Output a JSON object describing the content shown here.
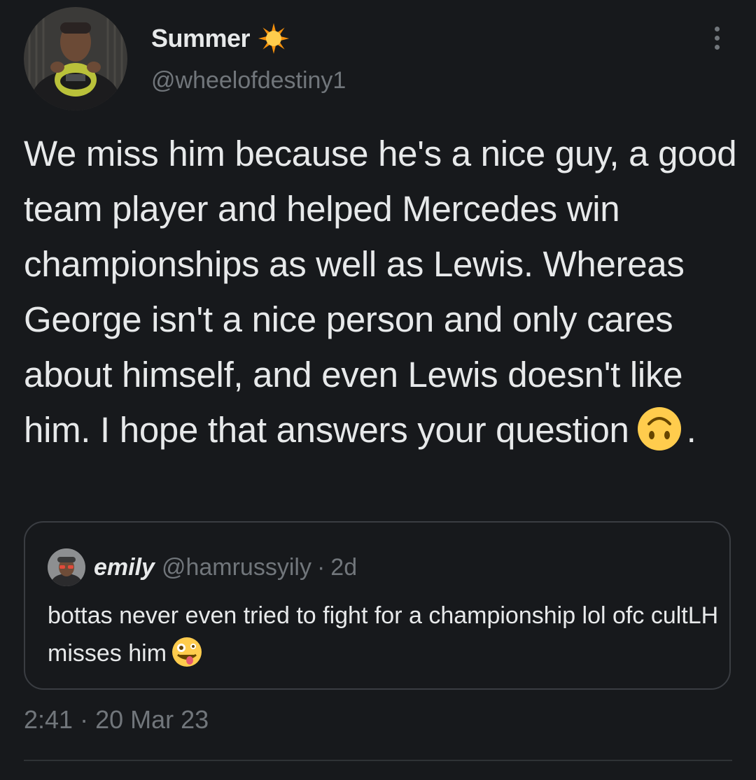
{
  "tweet": {
    "author": {
      "display_name": "Summer",
      "name_emoji": "sun-with-rays",
      "handle": "@wheelofdestiny1",
      "avatar": "profile-photo"
    },
    "menu_icon": "more-options-icon",
    "text_main": "We miss him because he's a nice guy, a good team player and helped Mercedes win championships as well as Lewis. Whereas George isn't a nice person and only cares about himself, and even Lewis doesn't like him. I hope that answers your question",
    "text_emoji": "upside-down-face",
    "text_tail": ".",
    "quoted_tweet": {
      "display_name": "emily",
      "handle": "@hamrussyily",
      "separator": "·",
      "age": "2d",
      "text": "bottas never even tried to fight for a championship lol ofc cultLH misses him",
      "text_emoji": "zany-face"
    },
    "time": "2:41",
    "separator": "·",
    "date": "20 Mar 23"
  },
  "colors": {
    "background": "#17191c",
    "text_primary": "#e7e9ea",
    "text_secondary": "#71767b",
    "border": "#3a3d42"
  }
}
